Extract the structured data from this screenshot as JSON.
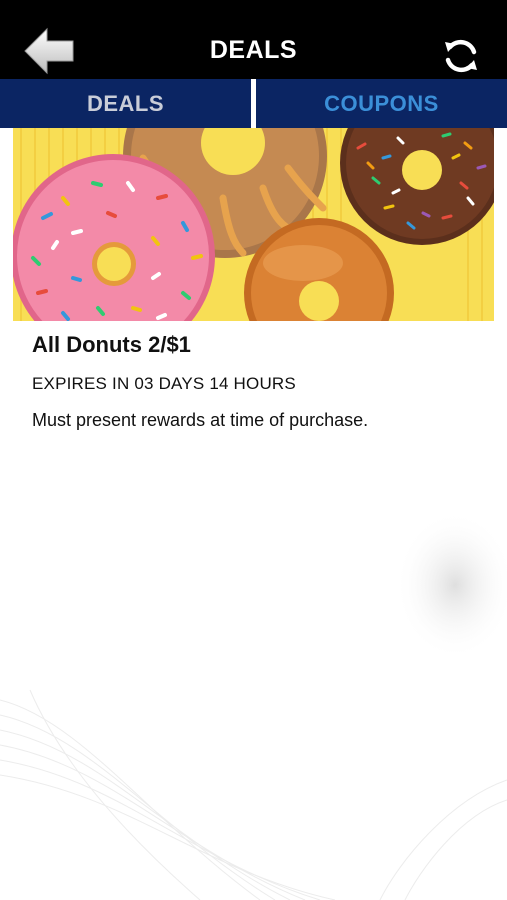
{
  "header": {
    "title": "DEALS",
    "back_icon": "back-arrow-icon",
    "refresh_icon": "refresh-icon"
  },
  "tabs": [
    {
      "label": "DEALS",
      "selected": false
    },
    {
      "label": "COUPONS",
      "selected": true
    }
  ],
  "deal": {
    "title": "All Donuts 2/$1",
    "expiry": "EXPIRES IN 03 DAYS 14 HOURS",
    "note": "Must present rewards at time of purchase.",
    "image": "donuts-image"
  },
  "colors": {
    "header_bg": "#000000",
    "tab_bar_bg": "#0b2563",
    "tab_inactive": "#c9cdd8",
    "tab_active": "#3b8fd8",
    "image_bg": "#f8de55"
  }
}
